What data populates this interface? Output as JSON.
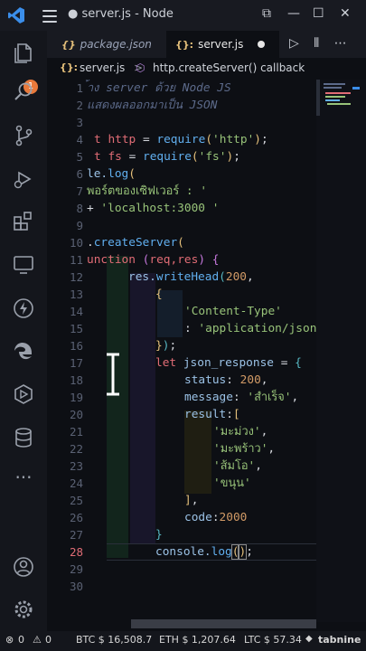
{
  "titlebar": {
    "title": "● server.js - Node",
    "controls": [
      "⧉",
      "—",
      "☐",
      "✕"
    ]
  },
  "activity_bar": {
    "badge_count": "1",
    "icons": [
      "explorer-icon",
      "search-icon",
      "source-control-icon",
      "run-debug-icon",
      "extensions-icon",
      "remote-icon",
      "lightning-icon",
      "edge-icon",
      "cube-icon",
      "database-icon",
      "more-icon",
      "account-icon",
      "settings-icon"
    ]
  },
  "tabs": [
    {
      "label": "package.json",
      "icon": "{}"
    },
    {
      "label": "server.js",
      "icon": "{}:",
      "modified": true
    }
  ],
  "tab_actions": [
    "▷",
    "⫴",
    "⋯"
  ],
  "breadcrumb": {
    "file": "server.js",
    "separator": ">",
    "symbol": "http.createServer() callback"
  },
  "editor": {
    "line_numbers": [
      "1",
      "2",
      "3",
      "4",
      "5",
      "6",
      "7",
      "8",
      "9",
      "10",
      "11",
      "12",
      "13",
      "14",
      "15",
      "16",
      "17",
      "18",
      "19",
      "20",
      "21",
      "22",
      "23",
      "24",
      "25",
      "26",
      "27",
      "28",
      "29",
      "30"
    ],
    "active_line": "28",
    "lines": {
      "l1": "้าง server ด้วย Node JS",
      "l2": "แสดงผลออกมาเป็น JSON",
      "l4_kw": "t",
      "l4_var": "http",
      "l4_op": " = ",
      "l4_fn": "require",
      "l4_str": "'http'",
      "l5_kw": "t",
      "l5_var": "fs",
      "l5_op": " = ",
      "l5_fn": "require",
      "l5_str": "'fs'",
      "l6_a": "le.",
      "l6_fn": "log",
      "l7_str": "พอร์ตของเซิฟเวอร์ : '",
      "l8_str": "'localhost:3000 '",
      "l10_fn": "createServer",
      "l11_kw": "unction",
      "l11_params": "req,res",
      "l12_obj": "res.",
      "l12_fn": "writeHead",
      "l12_num": "200",
      "l14_str": "'Content-Type'",
      "l15_str": "'application/json'",
      "l17_kw": "let",
      "l17_var": "json_response",
      "l18_key": "status",
      "l18_num": "200",
      "l19_key": "message",
      "l19_str": "'สำเร็จ'",
      "l20_key": "result",
      "l21_str": "'มะม่วง'",
      "l22_str": "'มะพร้าว'",
      "l23_str": "'ส้มโอ'",
      "l24_str": "'ขนุน'",
      "l26_key": "code",
      "l26_num": "2000",
      "l28_obj": "console.",
      "l28_fn": "log"
    }
  },
  "statusbar": {
    "errors": "0",
    "warnings": "0",
    "btc": "BTC $ 16,508.7",
    "eth": "ETH $ 1,207.64",
    "ltc": "LTC $ 57.34",
    "tabnine": "tabnine"
  },
  "colors": {
    "accent": "#4b7bd8",
    "badge": "#e8793b",
    "active_line_number": "#e06c75"
  }
}
